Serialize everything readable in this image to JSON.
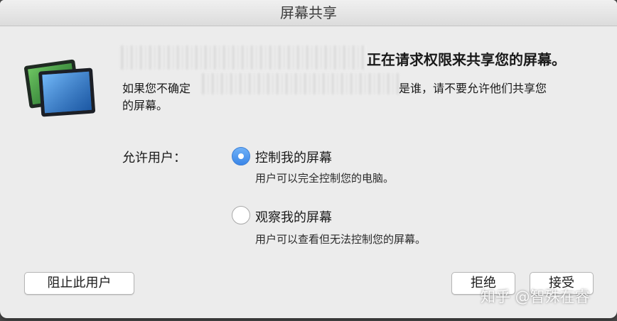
{
  "window": {
    "title": "屏幕共享"
  },
  "message": {
    "headline": "正在请求权限来共享您的屏幕。",
    "info_part1": "如果您不确定",
    "info_part2": "是谁，请不要允许他们共享您",
    "info_part3": "的屏幕。"
  },
  "permission": {
    "label": "允许用户：",
    "options": [
      {
        "title": "控制我的屏幕",
        "description": "用户可以完全控制您的电脑。",
        "selected": true
      },
      {
        "title": "观察我的屏幕",
        "description": "用户可以查看但无法控制您的屏幕。",
        "selected": false
      }
    ]
  },
  "buttons": {
    "block": "阻止此用户",
    "reject": "拒绝",
    "accept": "接受"
  },
  "watermark": "知乎 @智殊在睿",
  "colors": {
    "accent": "#3a86e8",
    "background": "#ececec"
  },
  "icons": {
    "app": "screen-sharing-icon"
  }
}
